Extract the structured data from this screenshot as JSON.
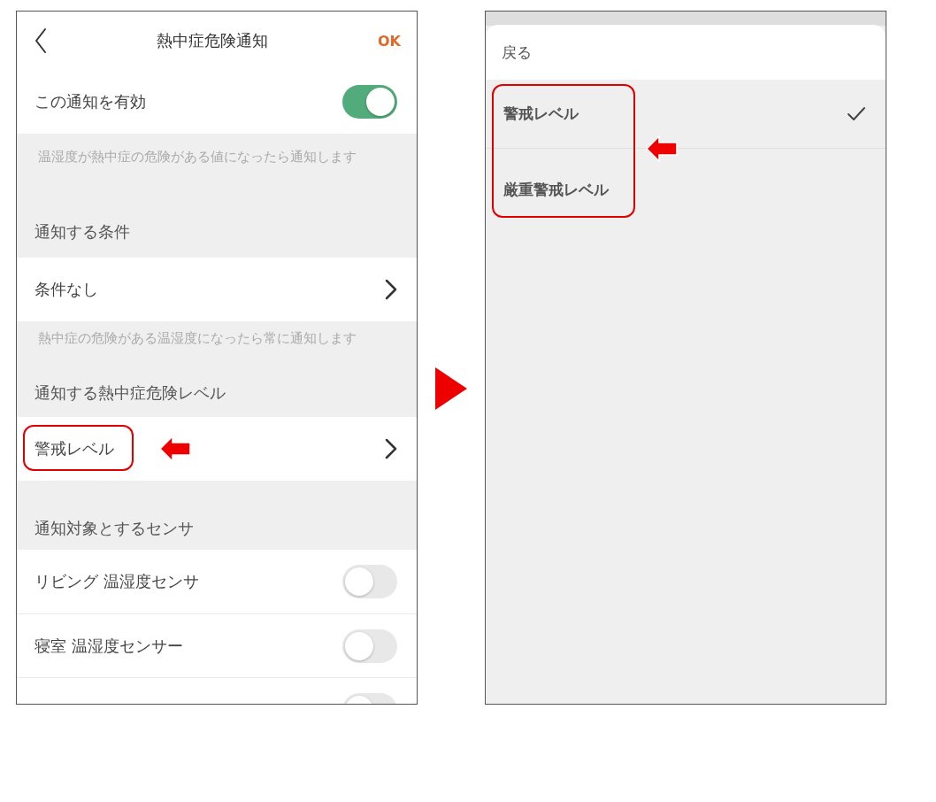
{
  "settings_screen": {
    "title": "熱中症危険通知",
    "ok": "OK",
    "enable_row": {
      "label": "この通知を有効",
      "on": true
    },
    "enable_note": "温湿度が熱中症の危険がある値になったら通知します",
    "condition_section": {
      "heading": "通知する条件",
      "value": "条件なし",
      "note": "熱中症の危険がある温湿度になったら常に通知します"
    },
    "level_section": {
      "heading": "通知する熱中症危険レベル",
      "value": "警戒レベル"
    },
    "sensor_section": {
      "heading": "通知対象とするセンサ",
      "sensors": [
        {
          "label": "リビング 温湿度センサ",
          "on": false
        },
        {
          "label": "寝室 温湿度センサー",
          "on": false
        },
        {
          "on": false
        }
      ]
    }
  },
  "level_picker": {
    "back": "戻る",
    "options": [
      {
        "label": "警戒レベル",
        "selected": true
      },
      {
        "label": "厳重警戒レベル",
        "selected": false
      }
    ]
  }
}
